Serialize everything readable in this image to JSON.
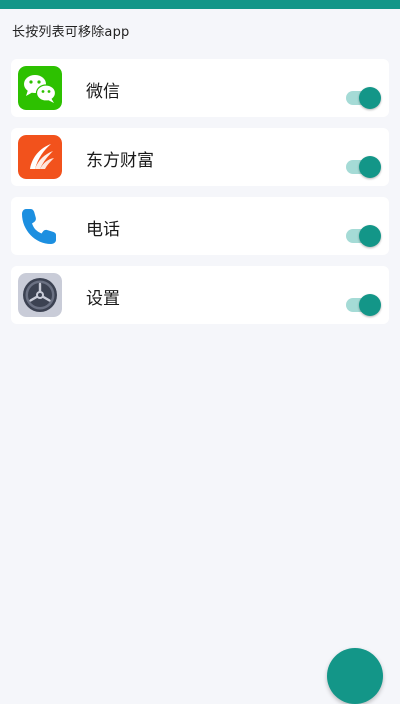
{
  "hint": "长按列表可移除app",
  "colors": {
    "accent": "#139688",
    "track": "#a5dbd6",
    "background": "#f5f6fa"
  },
  "apps": [
    {
      "name": "微信",
      "icon": "wechat-icon",
      "enabled": true
    },
    {
      "name": "东方财富",
      "icon": "eastmoney-icon",
      "enabled": true
    },
    {
      "name": "电话",
      "icon": "phone-icon",
      "enabled": true
    },
    {
      "name": "设置",
      "icon": "settings-gear-icon",
      "enabled": true
    }
  ]
}
